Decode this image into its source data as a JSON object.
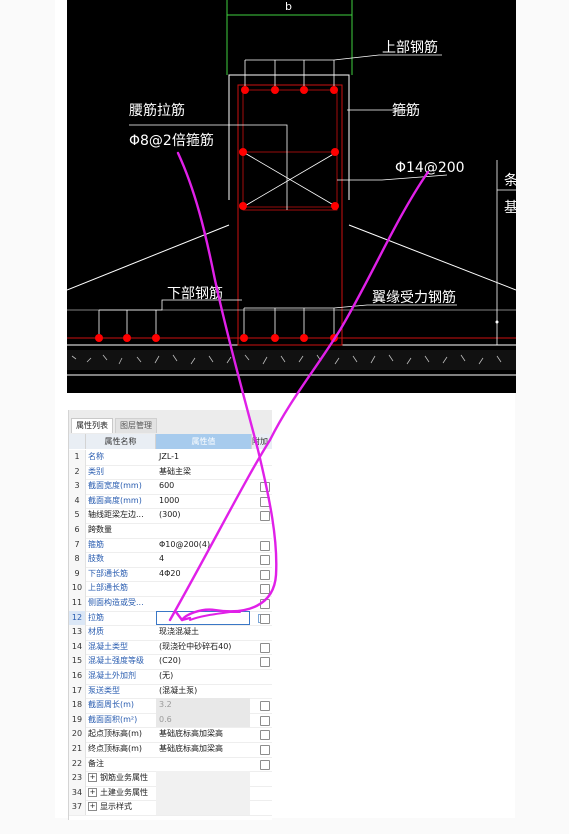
{
  "drawing": {
    "dim_label": "b",
    "label_top_rebar": "上部钢筋",
    "label_tie": "腰筋拉筋",
    "label_tie_spec": "Φ8@2倍箍筋",
    "label_stirrup": "箍筋",
    "label_wing_rebar_spec": "Φ14@200",
    "label_bottom_rebar": "下部钢筋",
    "label_wing_rebar": "翼缘受力钢筋",
    "label_edge_1": "条",
    "label_edge_2": "基"
  },
  "panel": {
    "tab_props": "属性列表",
    "tab_layers": "图层管理",
    "col_name": "属性名称",
    "col_value": "属性值",
    "col_add": "附加",
    "rows": [
      {
        "num": "1",
        "name": "名称",
        "value": "JZL-1"
      },
      {
        "num": "2",
        "name": "类别",
        "value": "基础主梁"
      },
      {
        "num": "3",
        "name": "截面宽度(mm)",
        "value": "600"
      },
      {
        "num": "4",
        "name": "截面高度(mm)",
        "value": "1000"
      },
      {
        "num": "5",
        "name": "轴线距梁左边...",
        "value": "(300)"
      },
      {
        "num": "6",
        "name": "跨数量",
        "value": ""
      },
      {
        "num": "7",
        "name": "箍筋",
        "value": "Φ10@200(4)"
      },
      {
        "num": "8",
        "name": "肢数",
        "value": "4"
      },
      {
        "num": "9",
        "name": "下部通长筋",
        "value": "4Φ20"
      },
      {
        "num": "10",
        "name": "上部通长筋",
        "value": ""
      },
      {
        "num": "11",
        "name": "侧面构造或受...",
        "value": ""
      },
      {
        "num": "12",
        "name": "拉筋",
        "value": ""
      },
      {
        "num": "13",
        "name": "材质",
        "value": "现浇混凝土"
      },
      {
        "num": "14",
        "name": "混凝土类型",
        "value": "(现浇砼中砂碎石40)"
      },
      {
        "num": "15",
        "name": "混凝土强度等级",
        "value": "(C20)"
      },
      {
        "num": "16",
        "name": "混凝土外加剂",
        "value": "(无)"
      },
      {
        "num": "17",
        "name": "泵送类型",
        "value": "(混凝土泵)"
      },
      {
        "num": "18",
        "name": "截面周长(m)",
        "value": "3.2"
      },
      {
        "num": "19",
        "name": "截面面积(m²)",
        "value": "0.6"
      },
      {
        "num": "20",
        "name": "起点顶标高(m)",
        "value": "基础底标高加梁高"
      },
      {
        "num": "21",
        "name": "终点顶标高(m)",
        "value": "基础底标高加梁高"
      },
      {
        "num": "22",
        "name": "备注",
        "value": ""
      },
      {
        "num": "23",
        "name": "钢筋业务属性",
        "value": ""
      },
      {
        "num": "34",
        "name": "土建业务属性",
        "value": ""
      },
      {
        "num": "37",
        "name": "显示样式",
        "value": ""
      }
    ]
  },
  "colors": {
    "annotation": "#e020e8",
    "rebar": "#ff0000",
    "cad_line": "#ffffff",
    "section": "#cc1111"
  }
}
